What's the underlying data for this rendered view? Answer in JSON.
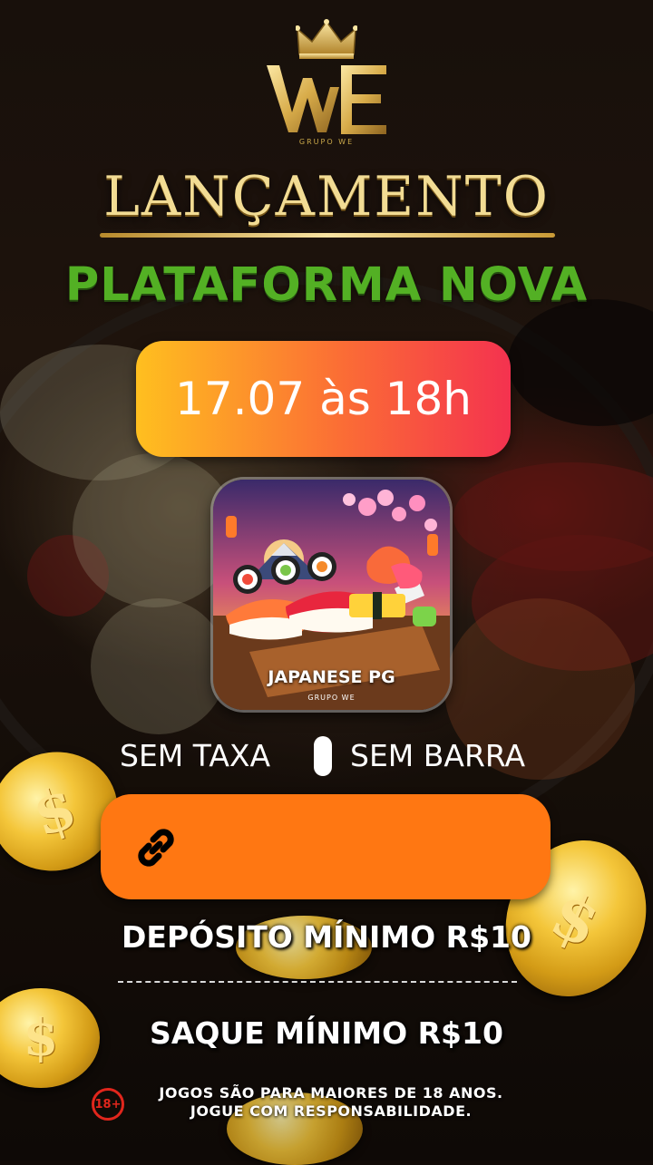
{
  "brand": {
    "logo_text": "WE",
    "group": "GRUPO WE"
  },
  "headline": {
    "title": "LANÇAMENTO",
    "subtitle": "PLATAFORMA NOVA"
  },
  "launch": {
    "datetime": "17.07 às 18h"
  },
  "app": {
    "name": "JAPANESE PG",
    "group": "GRUPO WE"
  },
  "features": {
    "left": "SEM TAXA",
    "right": "SEM BARRA"
  },
  "link": {
    "icon": "link-icon",
    "value": ""
  },
  "limits": {
    "deposit": "DEPÓSITO MÍNIMO R$10",
    "withdraw": "SAQUE MÍNIMO R$10"
  },
  "age_warning": {
    "badge": "18+",
    "line1": "JOGOS SÃO PARA MAIORES DE 18 ANOS.",
    "line2": "JOGUE COM RESPONSABILIDADE."
  },
  "colors": {
    "gold": "#f2dc94",
    "green": "#53b024",
    "orange": "#ff7712",
    "pill_start": "#ffbf1f",
    "pill_end": "#f4324f",
    "badge_red": "#e1261c"
  }
}
